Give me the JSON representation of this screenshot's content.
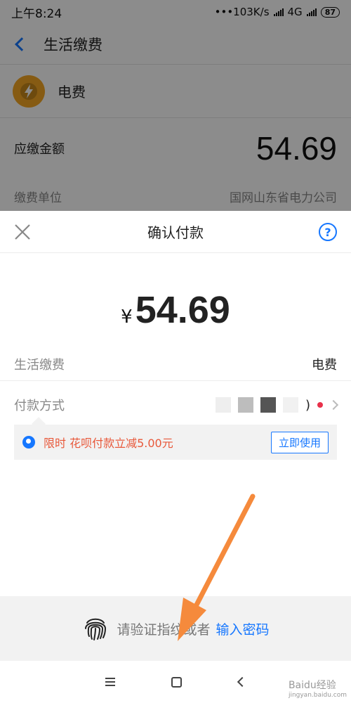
{
  "status_bar": {
    "time": "上午8:24",
    "network_speed": "103K/s",
    "network_type": "4G",
    "battery": "87"
  },
  "background": {
    "title": "生活缴费",
    "biller_name": "电费",
    "amount_label": "应缴金额",
    "amount_value": "54.69",
    "unit_label": "缴费单位",
    "unit_value": "国网山东省电力公司"
  },
  "sheet": {
    "title": "确认付款",
    "help_symbol": "?",
    "currency_symbol": "¥",
    "amount": "54.69",
    "item_label": "生活缴费",
    "item_value": "电费",
    "method_label": "付款方式",
    "method_suffix": ")",
    "promo_text": "限时 花呗付款立减5.00元",
    "promo_button": "立即使用"
  },
  "auth": {
    "prompt": "请验证指纹或者",
    "password_link": "输入密码"
  },
  "watermark": {
    "brand": "Baidu经验",
    "url": "jingyan.baidu.com"
  },
  "colors": {
    "accent": "#1677ff",
    "promo": "#e8583a",
    "annotation_arrow": "#f58a3c",
    "biller_logo": "#f5a623"
  }
}
